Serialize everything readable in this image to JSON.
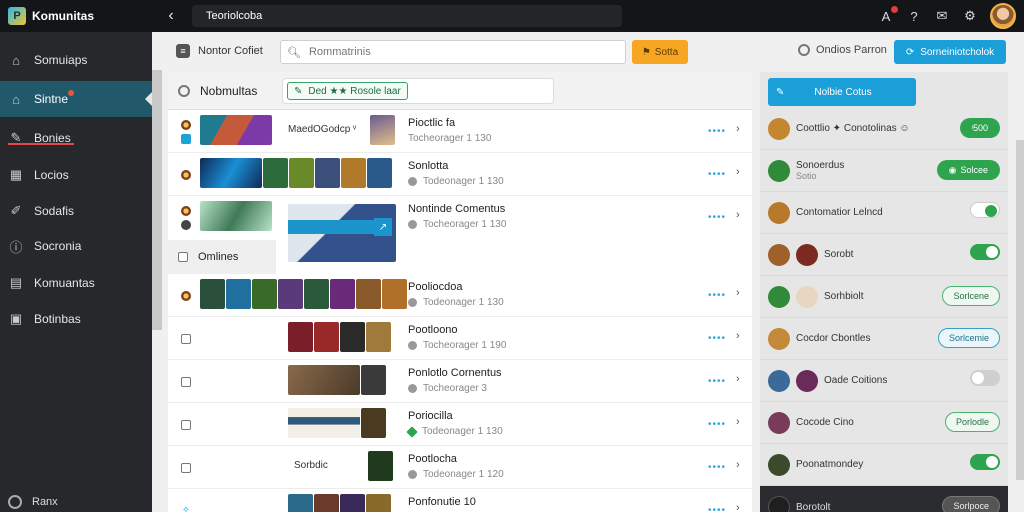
{
  "app": {
    "name": "Komunitas"
  },
  "header": {
    "title": "Teoriolcoba"
  },
  "sidebar": {
    "items": [
      {
        "label": "Somuiaps",
        "icon": "home-icon"
      },
      {
        "label": "Sintne",
        "icon": "community-icon",
        "active": true
      },
      {
        "label": "Bonies",
        "icon": "pencil-icon"
      },
      {
        "label": "Locios",
        "icon": "calendar-icon"
      },
      {
        "label": "Sodafis",
        "icon": "wrench-icon"
      },
      {
        "label": "Socronia",
        "icon": "info-icon"
      },
      {
        "label": "Komuantas",
        "icon": "document-icon"
      },
      {
        "label": "Botinbas",
        "icon": "folder-icon"
      }
    ],
    "user": {
      "label": "Ranx"
    }
  },
  "toolbar": {
    "sort_label": "Nontor Cofiet",
    "search_placeholder": "Rommatrinis",
    "filter_label": "Sotta",
    "status_label": "Ondios Parron",
    "action_label": "Sorneiniotcholok"
  },
  "list": {
    "header_label": "Nobmultas",
    "chip_label": "Ded ★★ Rosole laar",
    "online_label": "Omlines",
    "rows": [
      {
        "left_label": "MaedOGodcp ᵛ",
        "title": "Pioctlic fa",
        "sub": "Tocheorager 1 130"
      },
      {
        "left_label": "",
        "title": "Sonlotta",
        "sub": "Todeonager 1 130"
      },
      {
        "left_label": "",
        "title": "Nontinde Comentus",
        "sub": "Tocheorager 1 130"
      },
      {
        "left_label": "",
        "title": "Pooliocdoa",
        "sub": "Todeonager 1 130"
      },
      {
        "left_label": "",
        "title": "Pootloono",
        "sub": "Tocheorager 1 190"
      },
      {
        "left_label": "",
        "title": "Ponlotlo Cornentus",
        "sub": "Tocheorager 3"
      },
      {
        "left_label": "",
        "title": "Poriocilla",
        "sub": "Todeonager 1 130"
      },
      {
        "left_label": "Sorbdic",
        "title": "Pootlocha",
        "sub": "Todeonager 1 120"
      },
      {
        "left_label": "",
        "title": "Ponfonutie 10",
        "sub": ""
      }
    ]
  },
  "right_panel": {
    "action_label": "Nolbie Cotus",
    "rows": [
      {
        "name": "Coottlio ✦ Conotolinas ☺",
        "sub": "",
        "control": "pill",
        "control_label": "ᶦ500"
      },
      {
        "name": "Sonoerdus",
        "sub": "Sotio",
        "control": "pill",
        "control_label": "Solcee"
      },
      {
        "name": "Contomatior Lelncd",
        "sub": "",
        "control": "toggle",
        "on": true
      },
      {
        "name": "Sorobt",
        "sub": "",
        "control": "toggle",
        "on": true
      },
      {
        "name": "Sorhbiolt",
        "sub": "",
        "control": "outline",
        "control_label": "Sorlcene"
      },
      {
        "name": "Cocdor Cbontles",
        "sub": "",
        "control": "outline",
        "control_label": "Sorlcemie"
      },
      {
        "name": "Oade Coitions",
        "sub": "",
        "control": "toggle",
        "on": false
      },
      {
        "name": "Cocode Cino",
        "sub": "",
        "control": "outline",
        "control_label": "Porlodle"
      },
      {
        "name": "Poonatmondey",
        "sub": "",
        "control": "toggle",
        "on": true
      },
      {
        "name": "Borotolt",
        "sub": "",
        "control": "outline",
        "control_label": "Sorlpoce"
      }
    ]
  },
  "colors": {
    "accent_blue": "#1a9fd9",
    "accent_orange": "#f6a623",
    "success_green": "#2ea44f",
    "sidebar_active": "#21586a"
  }
}
